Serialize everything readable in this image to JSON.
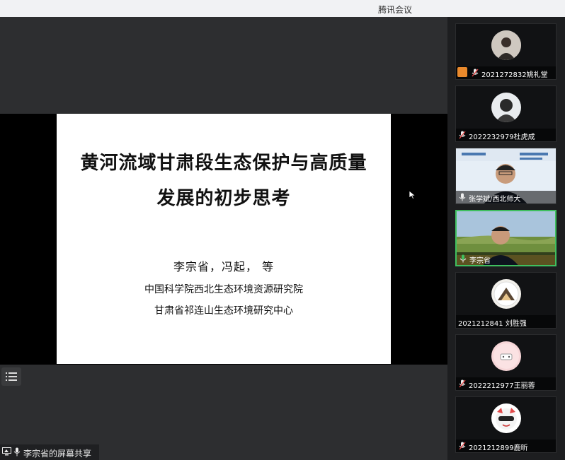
{
  "window": {
    "title": "腾讯会议"
  },
  "slide": {
    "title_line1": "黄河流域甘肃段生态保护与高质量",
    "title_line2": "发展的初步思考",
    "authors": "李宗省，冯起， 等",
    "affiliation1": "中国科学院西北生态环境资源研究院",
    "affiliation2": "甘肃省祁连山生态环境研究中心"
  },
  "share_status": {
    "label": "李宗省的屏幕共享"
  },
  "participants": [
    {
      "name": "2021272832姚礼堂",
      "host": true,
      "mic": "muted",
      "avatar": "portrait-avatar"
    },
    {
      "name": "2022232979杜虎成",
      "host": false,
      "mic": "muted",
      "avatar": "portrait-avatar"
    },
    {
      "name": "张学斌/西北师大",
      "host": false,
      "mic": "on",
      "avatar": "camera-video"
    },
    {
      "name": "李宗省",
      "host": false,
      "mic": "speaking",
      "avatar": "camera-video",
      "active": true
    },
    {
      "name": "2021212841 刘胜强",
      "host": false,
      "mic": "none",
      "avatar": "landscape-avatar"
    },
    {
      "name": "2022212977王丽蓉",
      "host": false,
      "mic": "muted",
      "avatar": "cartoon-avatar"
    },
    {
      "name": "2021212899鹿昕",
      "host": false,
      "mic": "muted",
      "avatar": "cartoon-avatar"
    }
  ],
  "colors": {
    "active_border": "#3fbf5f",
    "host_badge": "#e9892c",
    "speaking_mic": "#3fbf5f",
    "muted_mic": "#e64545"
  }
}
